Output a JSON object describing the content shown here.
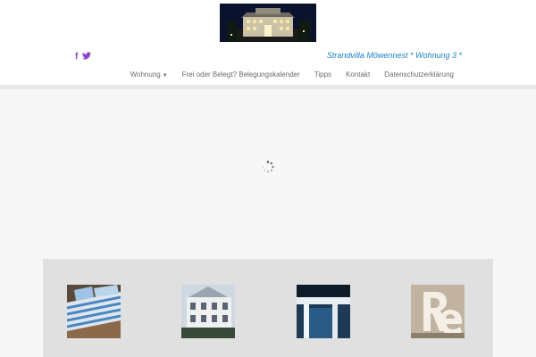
{
  "header": {
    "logo": {
      "alt": "Strandvilla Möwennest at night"
    },
    "social": [
      {
        "name": "facebook",
        "glyph": "f",
        "color": "#8a44c8"
      },
      {
        "name": "twitter",
        "glyph": "🐦",
        "color": "#8a44c8"
      }
    ],
    "site_title": "Strandvilla Möwennest * Wohnung 3 *",
    "site_title_color": "#1a80c4",
    "nav": [
      {
        "label": "Wohnung",
        "has_dropdown": true
      },
      {
        "label": "Frei oder Belegt? Belegungskalender"
      },
      {
        "label": "Tipps"
      },
      {
        "label": "Kontakt"
      },
      {
        "label": "Datenschutzerklärung"
      }
    ]
  },
  "main": {
    "loading": true
  },
  "gallery": {
    "items": [
      {
        "subject": "bed with striped bedding"
      },
      {
        "subject": "villa facade"
      },
      {
        "subject": "window with blue light"
      },
      {
        "subject": "decorative letters"
      }
    ]
  }
}
